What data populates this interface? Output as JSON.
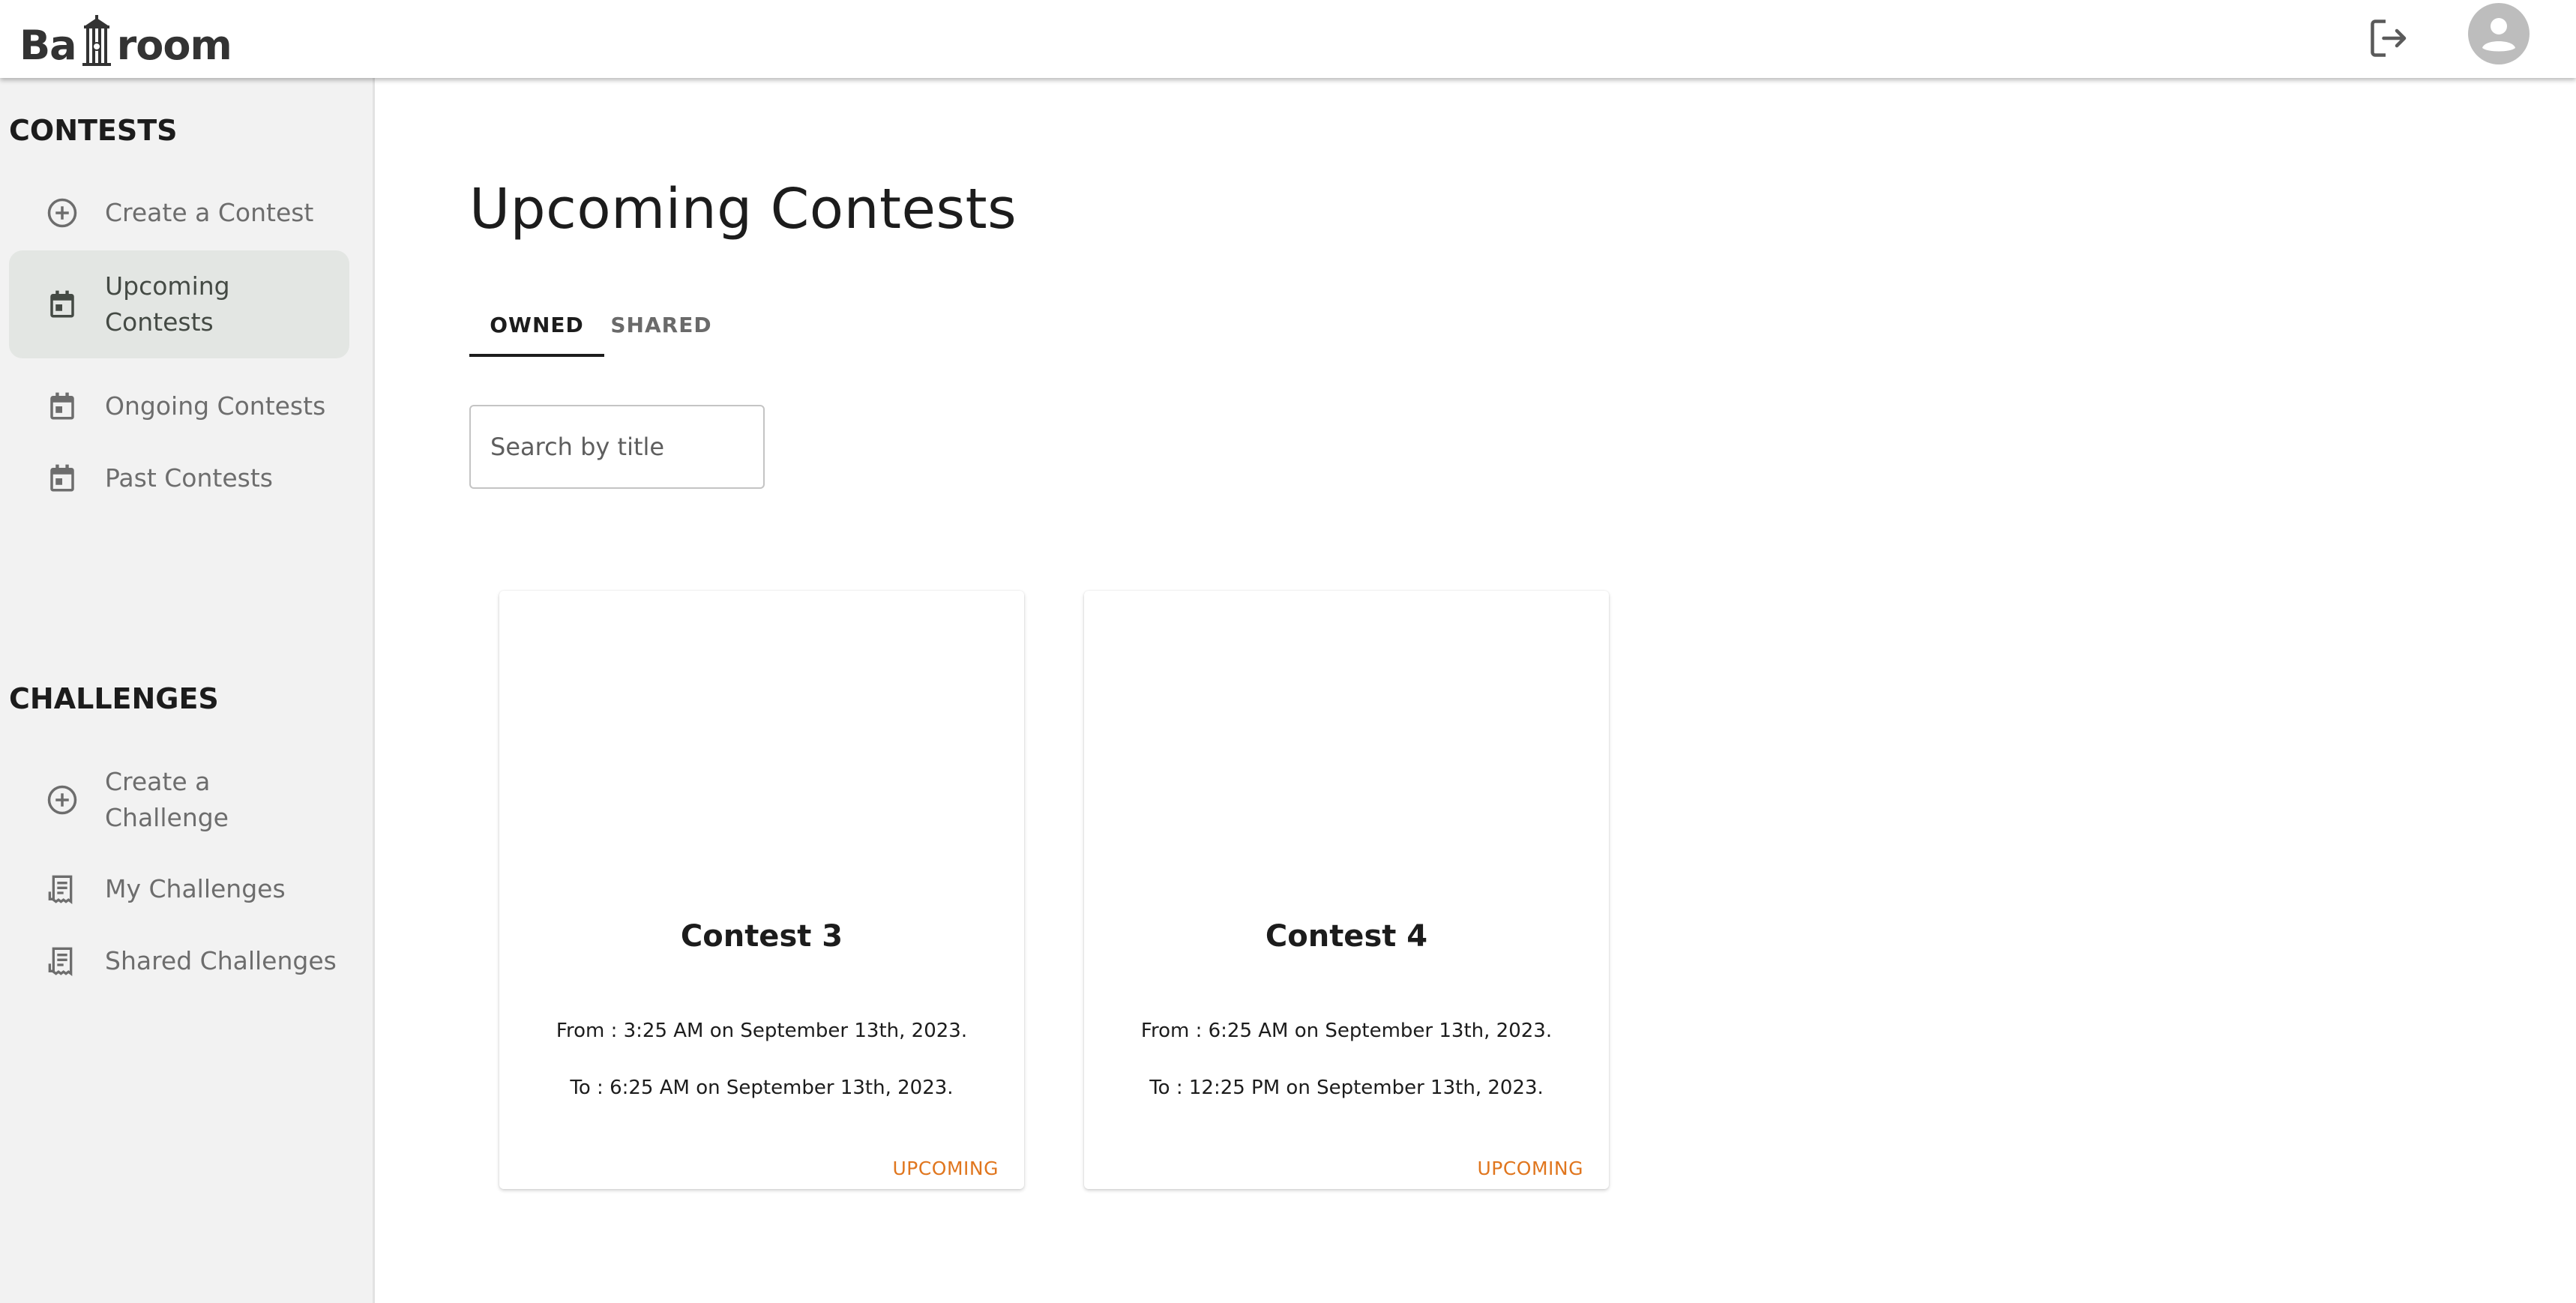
{
  "app": {
    "logo_text_left": "Ba",
    "logo_text_right": "room",
    "logo_icon": "tower-icon"
  },
  "header": {
    "logout_icon": "logout-icon",
    "avatar_icon": "account-circle-icon"
  },
  "sidebar": {
    "contests_title": "CONTESTS",
    "contests_items": [
      {
        "label": "Create a Contest",
        "icon": "add-circle-icon"
      },
      {
        "label": "Upcoming Contests",
        "icon": "calendar-icon",
        "active": true
      },
      {
        "label": "Ongoing Contests",
        "icon": "calendar-icon"
      },
      {
        "label": "Past Contests",
        "icon": "calendar-icon"
      }
    ],
    "challenges_title": "CHALLENGES",
    "challenges_items": [
      {
        "label": "Create a Challenge",
        "icon": "add-circle-icon"
      },
      {
        "label": "My Challenges",
        "icon": "receipt-icon"
      },
      {
        "label": "Shared Challenges",
        "icon": "receipt-icon"
      }
    ]
  },
  "main": {
    "title": "Upcoming Contests",
    "tabs": [
      {
        "label": "OWNED",
        "selected": true
      },
      {
        "label": "SHARED",
        "selected": false
      }
    ],
    "search": {
      "placeholder": "Search by title",
      "value": ""
    },
    "cards": [
      {
        "title": "Contest 3",
        "from": "From : 3:25 AM on September 13th, 2023.",
        "to": "To : 6:25 AM on September 13th, 2023.",
        "status": "UPCOMING"
      },
      {
        "title": "Contest 4",
        "from": "From : 6:25 AM on September 13th, 2023.",
        "to": "To : 12:25 PM on September 13th, 2023.",
        "status": "UPCOMING"
      }
    ]
  },
  "colors": {
    "accent_status": "#e0761e",
    "sidebar_bg": "#f2f2f2",
    "active_item_bg": "#e3e6e3",
    "text_primary": "#1c1c1c"
  }
}
